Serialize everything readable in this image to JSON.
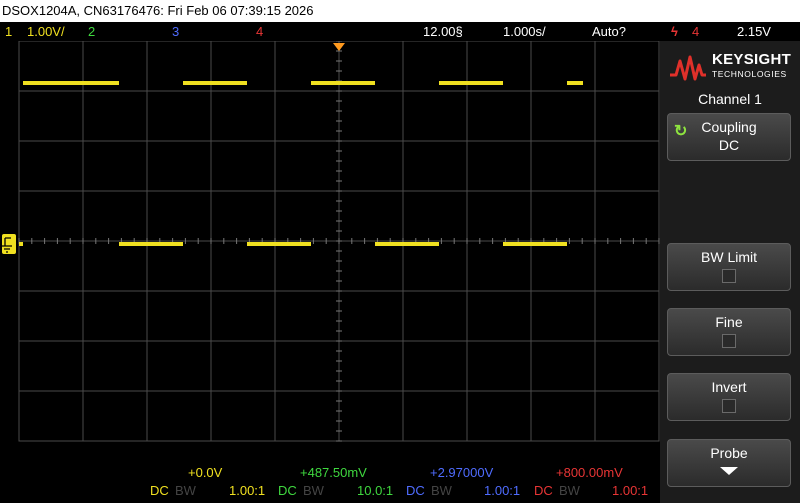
{
  "title": "DSOX1204A, CN63176476: Fri Feb 06 07:39:15 2026",
  "status": {
    "ch1_num": "1",
    "ch1_scale": "1.00V/",
    "ch2_num": "2",
    "ch3_num": "3",
    "ch4_num": "4",
    "time_scale": "12.00§",
    "delay": "1.000s/",
    "trigger_mode": "Auto?",
    "trigger_icon": "ϟ",
    "trigger_channel": "4",
    "trigger_level": "2.15V"
  },
  "panel": {
    "brand": "KEYSIGHT",
    "brand_sub": "TECHNOLOGIES",
    "menu_title": "Channel 1",
    "coupling_label": "Coupling",
    "coupling_value": "DC",
    "bw_limit_label": "BW Limit",
    "fine_label": "Fine",
    "invert_label": "Invert",
    "probe_label": "Probe"
  },
  "channels": [
    {
      "offset": "+0.0V",
      "coupling": "DC",
      "bw": "BW",
      "probe": "1.00:1",
      "color": "#f0e020"
    },
    {
      "offset": "+487.50mV",
      "coupling": "DC",
      "bw": "BW",
      "probe": "10.0:1",
      "color": "#3fd83f"
    },
    {
      "offset": "+2.97000V",
      "coupling": "DC",
      "bw": "BW",
      "probe": "1.00:1",
      "color": "#4f6cff"
    },
    {
      "offset": "+800.00mV",
      "coupling": "DC",
      "bw": "BW",
      "probe": "1.00:1",
      "color": "#e83535"
    }
  ],
  "colors": {
    "trace": "#f0e020",
    "grid": "#4a4a4a",
    "trigger_marker": "#ff9a1f"
  },
  "waveform": {
    "high_segments": [
      [
        0,
        3
      ],
      [
        5,
        7
      ],
      [
        9,
        11
      ],
      [
        13,
        15
      ],
      [
        17,
        17.5
      ]
    ],
    "low_segments": [
      [
        3,
        5
      ],
      [
        7,
        9
      ],
      [
        11,
        13
      ],
      [
        15,
        17
      ]
    ]
  }
}
